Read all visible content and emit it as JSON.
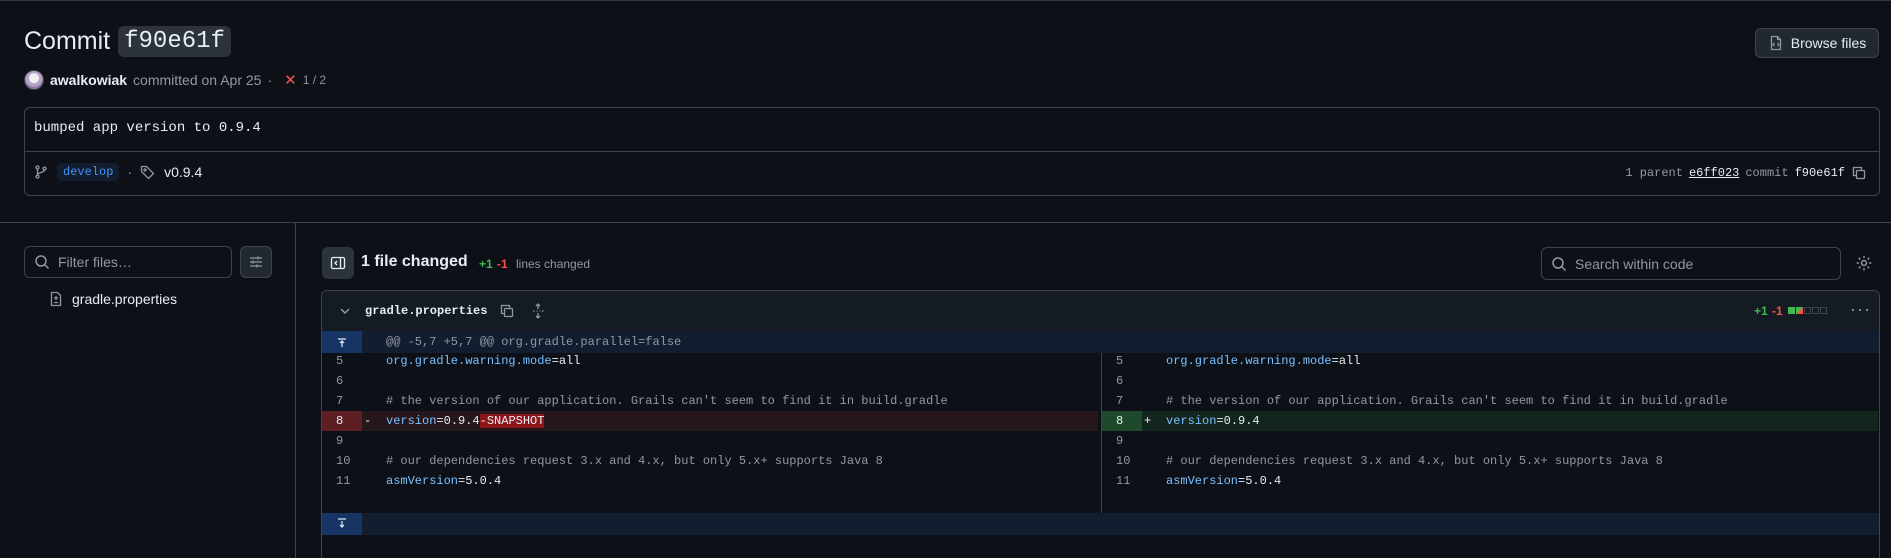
{
  "commit": {
    "title_prefix": "Commit",
    "sha": "f90e61f",
    "author": "awalkowiak",
    "committed_text": "committed on Apr 25",
    "separator": "·",
    "checks": "1 / 2",
    "message": "bumped app version to 0.9.4",
    "branch": "develop",
    "tag": "v0.9.4",
    "parent_label": "1 parent",
    "parent_sha": "e6ff023",
    "commit_label": "commit",
    "commit_sha": "f90e61f"
  },
  "toolbar": {
    "browse_files": "Browse files"
  },
  "sidebar": {
    "filter_placeholder": "Filter files…",
    "files": [
      {
        "name": "gradle.properties"
      }
    ]
  },
  "diff_header": {
    "files_changed": "1 file changed",
    "additions": "+1",
    "deletions": "-1",
    "lines_changed": "lines changed",
    "search_placeholder": "Search within code"
  },
  "file": {
    "name": "gradle.properties",
    "additions": "+1",
    "deletions": "-1",
    "hunk_header": "@@ -5,7 +5,7 @@ org.gradle.parallel=false",
    "left": [
      {
        "ln": "5",
        "key": "org.gradle.warning.mode",
        "eq": "=",
        "val": "all"
      },
      {
        "ln": "6"
      },
      {
        "ln": "7",
        "comment": "# the version of our application. Grails can't seem to find it in build.gradle"
      },
      {
        "ln": "8",
        "marker": "-",
        "key": "version",
        "eq": "=",
        "val": "0.9.4",
        "removed": "-SNAPSHOT"
      },
      {
        "ln": "9"
      },
      {
        "ln": "10",
        "comment": "# our dependencies request 3.x and 4.x, but only 5.x+ supports Java 8"
      },
      {
        "ln": "11",
        "key": "asmVersion",
        "eq": "=",
        "val": "5.0.4"
      }
    ],
    "right": [
      {
        "ln": "5",
        "key": "org.gradle.warning.mode",
        "eq": "=",
        "val": "all"
      },
      {
        "ln": "6"
      },
      {
        "ln": "7",
        "comment": "# the version of our application. Grails can't seem to find it in build.gradle"
      },
      {
        "ln": "8",
        "marker": "+",
        "key": "version",
        "eq": "=",
        "val": "0.9.4"
      },
      {
        "ln": "9"
      },
      {
        "ln": "10",
        "comment": "# our dependencies request 3.x and 4.x, but only 5.x+ supports Java 8"
      },
      {
        "ln": "11",
        "key": "asmVersion",
        "eq": "=",
        "val": "5.0.4"
      }
    ]
  },
  "colors": {
    "addition": "#3fb950",
    "deletion": "#f85149",
    "link": "#4493f8"
  }
}
